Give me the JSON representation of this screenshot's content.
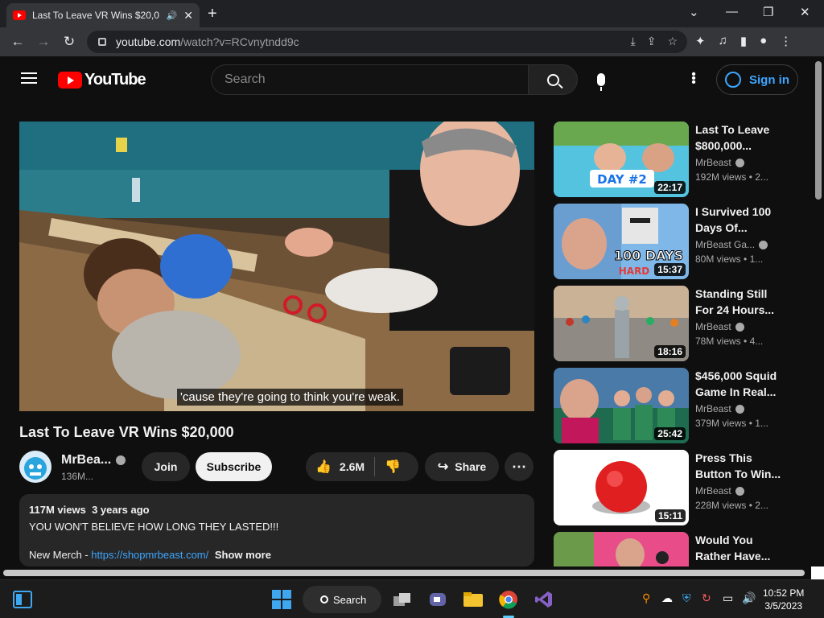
{
  "browser": {
    "tab_title": "Last To Leave VR Wins $20,0",
    "url_host": "youtube.com",
    "url_path": "/watch?v=RCvnytndd9c"
  },
  "youtube": {
    "logo_text": "YouTube",
    "search_placeholder": "Search",
    "signin_label": "Sign in"
  },
  "video": {
    "caption": "'cause they're going to think you're weak.",
    "title": "Last To Leave VR Wins $20,000",
    "channel": "MrBea...",
    "subscribers": "136M...",
    "join_label": "Join",
    "subscribe_label": "Subscribe",
    "likes": "2.6M",
    "share_label": "Share",
    "views": "117M views",
    "age": "3 years ago",
    "description_line1": "YOU WON'T BELIEVE HOW LONG THEY LASTED!!!",
    "merch_prefix": "New Merch - ",
    "merch_link": "https://shopmrbeast.com/",
    "show_more": "Show more"
  },
  "recommendations": [
    {
      "title": "Last To Leave $800,000...",
      "channel": "MrBeast",
      "views": "192M views",
      "age": "• 2...",
      "duration": "22:17",
      "thumb_text": "DAY #2"
    },
    {
      "title": "I Survived 100 Days Of...",
      "channel": "MrBeast Ga...",
      "views": "80M views",
      "age": "• 1...",
      "duration": "15:37",
      "thumb_text": "100 DAYS",
      "thumb_text2": "HARD"
    },
    {
      "title": "Standing Still For 24 Hours...",
      "channel": "MrBeast",
      "views": "78M views",
      "age": "• 4...",
      "duration": "18:16"
    },
    {
      "title": "$456,000 Squid Game In Real...",
      "channel": "MrBeast",
      "views": "379M views",
      "age": "• 1...",
      "duration": "25:42"
    },
    {
      "title": "Press This Button To Win...",
      "channel": "MrBeast",
      "views": "228M views",
      "age": "• 2...",
      "duration": "15:11"
    },
    {
      "title": "Would You Rather Have..."
    }
  ],
  "taskbar": {
    "search_label": "Search",
    "time": "10:52 PM",
    "date": "3/5/2023"
  }
}
